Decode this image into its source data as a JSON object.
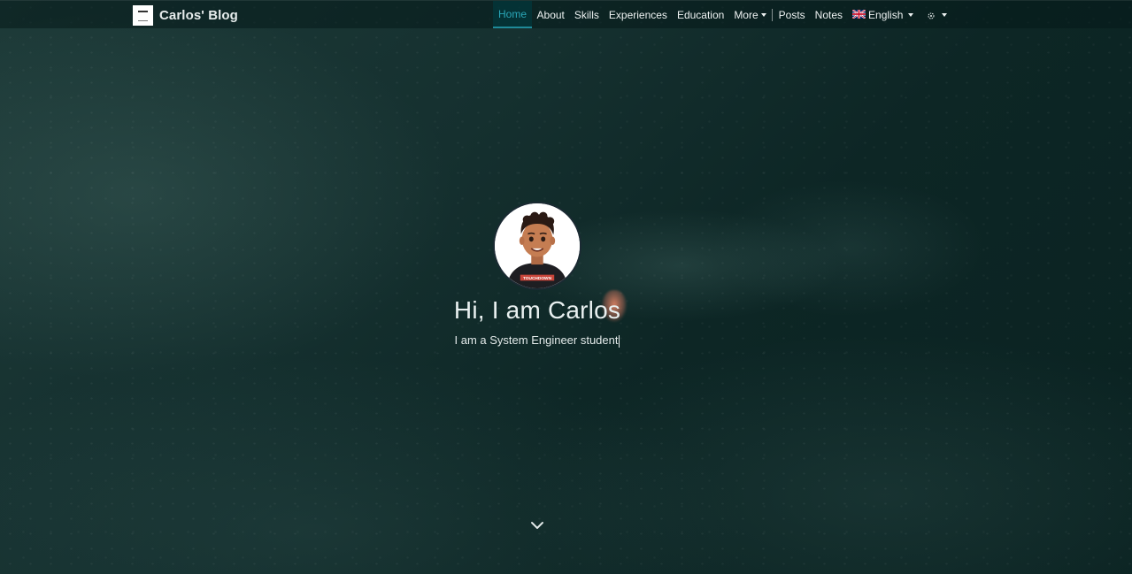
{
  "navbar": {
    "brand_name": "Carlos' Blog",
    "items": [
      {
        "label": "Home",
        "active": true
      },
      {
        "label": "About"
      },
      {
        "label": "Skills"
      },
      {
        "label": "Experiences"
      },
      {
        "label": "Education"
      },
      {
        "label": "More",
        "dropdown": true
      },
      {
        "label": "Posts"
      },
      {
        "label": "Notes"
      }
    ],
    "language": {
      "label": "English",
      "icon": "uk-flag-icon"
    },
    "theme_toggle": {
      "icon": "theme-toggle-icon"
    }
  },
  "hero": {
    "greeting": "Hi, I am Carlos",
    "subtitle": "I am a System Engineer student",
    "avatar_icon": "avatar",
    "scroll_icon": "chevron-down-icon"
  },
  "colors": {
    "accent": "#2aa7b8",
    "background": "#0f2a29",
    "text": "#e9f0f0"
  }
}
